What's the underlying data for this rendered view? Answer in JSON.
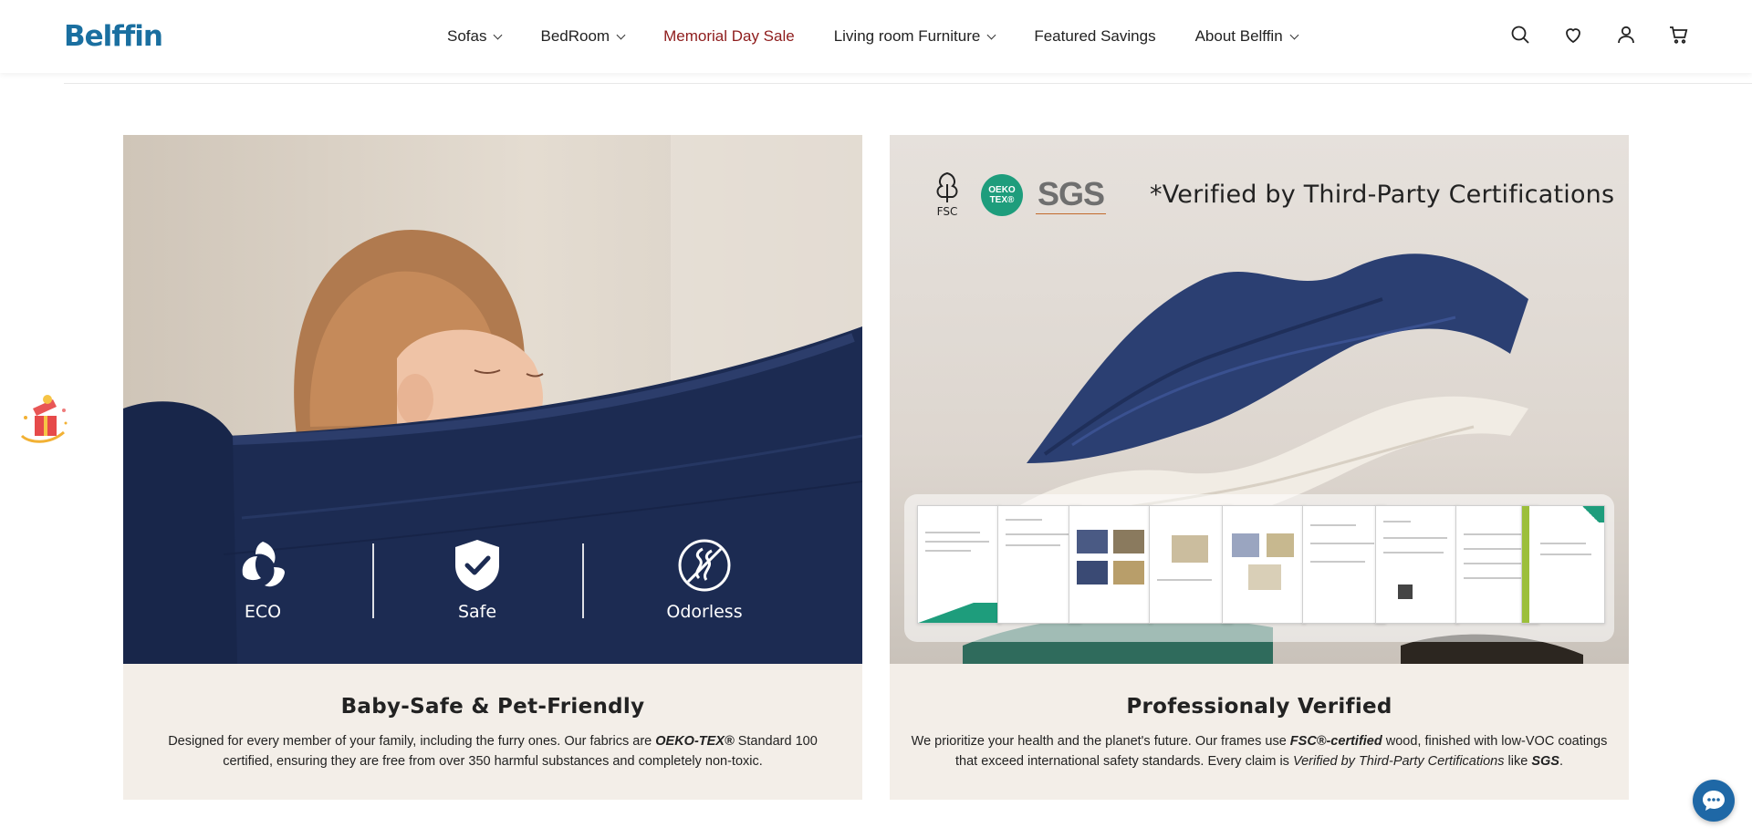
{
  "brand": {
    "logo_text": "Belffin",
    "color": "#1a6fa0"
  },
  "nav": {
    "items": [
      {
        "label": "Sofas",
        "has_dropdown": true
      },
      {
        "label": "BedRoom",
        "has_dropdown": true
      },
      {
        "label": "Memorial Day Sale",
        "has_dropdown": false,
        "highlight_color": "#8e1c1c"
      },
      {
        "label": "Living room Furniture",
        "has_dropdown": true
      },
      {
        "label": "Featured Savings",
        "has_dropdown": false
      },
      {
        "label": "About Belffin",
        "has_dropdown": true
      }
    ]
  },
  "header_icons": [
    "search-icon",
    "heart-icon",
    "user-icon",
    "cart-icon"
  ],
  "cards": {
    "left": {
      "badges": [
        {
          "label": "ECO",
          "icon": "eco-leaves-icon"
        },
        {
          "label": "Safe",
          "icon": "shield-check-icon"
        },
        {
          "label": "Odorless",
          "icon": "no-smell-icon"
        }
      ],
      "title": "Baby-Safe & Pet-Friendly",
      "text_1": "Designed for every member of your family, including the furry ones. Our fabrics are ",
      "text_em": "OEKO-TEX®",
      "text_2": " Standard 100 certified, ensuring they are free from over 350 harmful substances and completely non-toxic."
    },
    "right": {
      "logos": {
        "fsc": "FSC",
        "oeko": "OEKO TEX®",
        "sgs": "SGS"
      },
      "headline": "*Verified by Third-Party Certifications",
      "title": "Professionaly Verified",
      "text_1": "We prioritize your health and the planet's future. Our frames use ",
      "text_b1": "FSC®-certified",
      "text_2": " wood, finished with low-VOC coatings that exceed international safety standards. Every claim is ",
      "text_i": "Verified by Third-Party Certifications",
      "text_3": " like ",
      "text_b2": "SGS",
      "text_4": "."
    }
  },
  "colors": {
    "card_bg": "#f3eee8",
    "sofa_navy": "#1c2b52",
    "chat_blue": "#1f68a6"
  }
}
